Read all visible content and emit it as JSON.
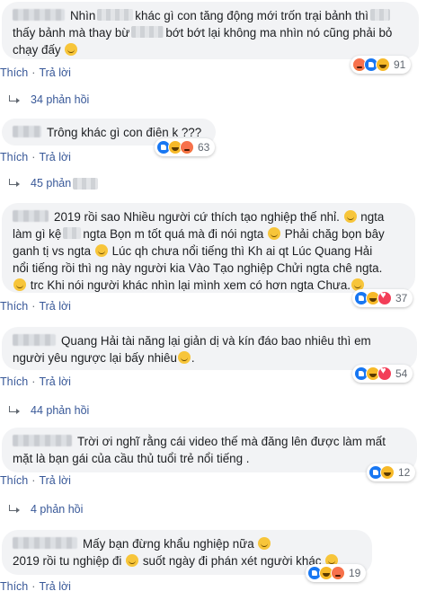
{
  "comments": [
    {
      "line1": "Nhìn",
      "line1b": "khác gì con tăng động mới trốn trại bảnh thì",
      "line2": "thấy bảnh mà thay bừ",
      "line2b": "bớt bớt lại không ma nhìn nó cũng phải bỏ",
      "line3": "chạy đấy",
      "reaction_count": "91",
      "reactions": [
        "angry-icon",
        "like-icon",
        "haha-icon"
      ],
      "replies": "34 phản hồi"
    },
    {
      "line1": "Trông khác gì con điên k ???",
      "reaction_count": "63",
      "reactions": [
        "like-icon",
        "haha-icon",
        "angry-icon"
      ],
      "replies": "45 phản"
    },
    {
      "line1": "2019 rồi sao Nhiều người cứ thích tạo nghiệp thế nhỉ.",
      "line1b": "ngta",
      "line2": "làm gì kệ",
      "line2b": "ngta Bọn m tốt quá mà đi nói ngta",
      "line2c": "Phải chăg bọn bây",
      "line3": "ganh tị vs ngta",
      "line3b": "Lúc qh chưa nổi tiếng thì Kh ai qt Lúc Quang Hải",
      "line4": "nổi tiếng rồi thì ng này người kia Vào Tạo nghiệp Chửi ngta chê ngta.",
      "line5": "trc Khi nói người khác nhìn lại mình xem có hơn ngta Chưa.",
      "reaction_count": "37",
      "reactions": [
        "like-icon",
        "haha-icon",
        "love-icon"
      ]
    },
    {
      "line1": "Quang Hải tài năng lại giản dị và kín đáo bao nhiêu thì em",
      "line2": "người yêu ngược lại bấy nhiêu",
      "reaction_count": "54",
      "reactions": [
        "like-icon",
        "haha-icon",
        "love-icon"
      ],
      "replies": "44 phản hồi"
    },
    {
      "line1": "Trời ơi nghĩ rằng cái video thế mà đăng lên được làm mất",
      "line2": "mặt là bạn gái của cầu thủ tuổi trẻ nổi tiếng .",
      "reaction_count": "12",
      "reactions": [
        "like-icon",
        "haha-icon"
      ],
      "replies": "4 phản hồi"
    },
    {
      "line1": "Mấy bạn đừng khẩu nghiệp nữa",
      "line2": "2019 rồi tu nghiệp đi",
      "line2b": "suốt ngày đi phán xét người khác",
      "reaction_count": "19",
      "reactions": [
        "like-icon",
        "haha-icon",
        "angry-icon"
      ]
    }
  ],
  "actions": {
    "like": "Thích",
    "reply": "Trả lời",
    "separator": "·"
  },
  "colors": {
    "bubble": "#f2f3f5",
    "link": "#385898",
    "text": "#1c1e21"
  }
}
